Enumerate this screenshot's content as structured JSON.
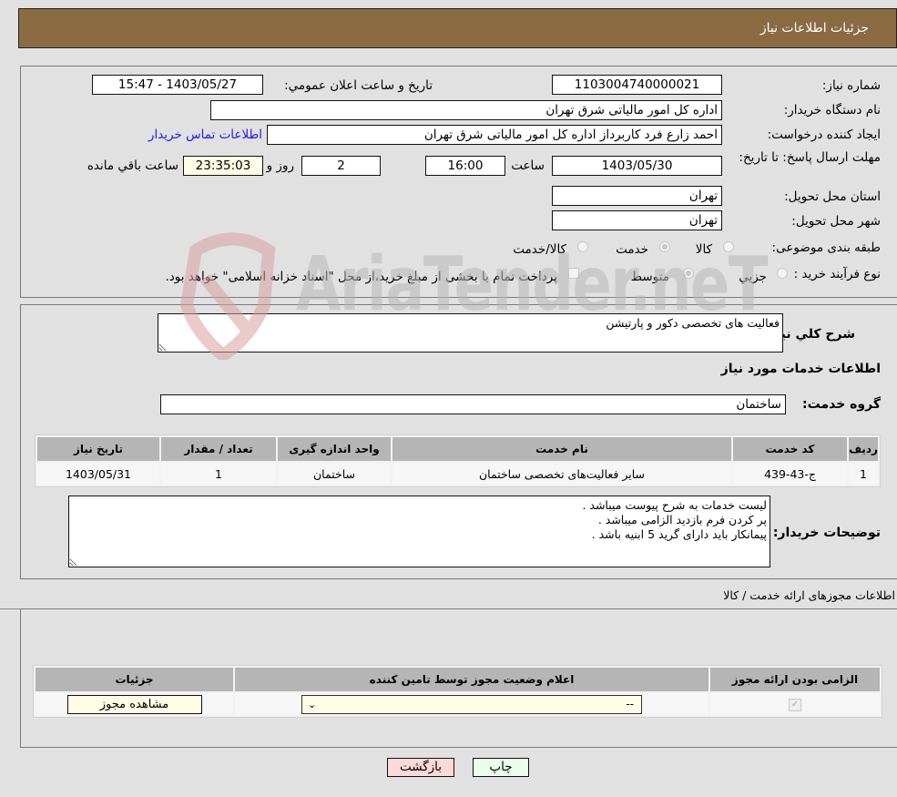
{
  "header": {
    "title": "جزئیات اطلاعات نیاز"
  },
  "info": {
    "need_number_label": "شماره نیاز:",
    "need_number": "1103004740000021",
    "announce_label": "تاریخ و ساعت اعلان عمومي:",
    "announce_value": "1403/05/27 - 15:47",
    "buyer_org_label": "نام دستگاه خریدار:",
    "buyer_org": "اداره کل امور مالیاتی شرق تهران",
    "creator_label": "ایجاد کننده درخواست:",
    "creator": "احمد  زارع فرد کاربرداز اداره کل امور مالیاتی شرق تهران",
    "buyer_contact_link": "اطلاعات تماس خریدار",
    "deadline_label": "مهلت ارسال پاسخ: تا تاریخ:",
    "deadline_date": "1403/05/30",
    "time_label": "ساعت",
    "deadline_time": "16:00",
    "days_value": "2",
    "days_label": "روز و",
    "remaining_time": "23:35:03",
    "remaining_label": "ساعت باقي مانده",
    "province_label": "استان محل تحویل:",
    "province": "تهران",
    "city_label": "شهر محل تحویل:",
    "city": "تهران",
    "category_label": "طبقه بندی موضوعی:",
    "category_options": [
      {
        "label": "کالا",
        "checked": false
      },
      {
        "label": "خدمت",
        "checked": true
      },
      {
        "label": "کالا/خدمت",
        "checked": false
      }
    ],
    "purchase_type_label": "نوع فرآیند خرید :",
    "purchase_type_options": [
      {
        "label": "جزیي",
        "checked": false
      },
      {
        "label": "متوسط",
        "checked": true
      }
    ],
    "treasury_checkbox_label": "پرداخت تمام یا بخشی از مبلغ خرید،از محل \"اسناد خزانه اسلامی\" خواهد بود.",
    "treasury_checked": false
  },
  "details": {
    "general_desc_label": "شرح کلي نیاز:",
    "general_desc": "فعالیت های تخصصی دکور و پارتیشن",
    "services_heading": "اطلاعات خدمات مورد نیاز",
    "service_group_label": "گروه خدمت:",
    "service_group": "ساختمان",
    "table": {
      "headers": [
        "ردیف",
        "کد خدمت",
        "نام خدمت",
        "واحد اندازه گیری",
        "تعداد / مقدار",
        "تاریخ نیاز"
      ],
      "rows": [
        [
          "1",
          "ج-43-439",
          "سایر فعالیت‌های تخصصی ساختمان",
          "ساختمان",
          "1",
          "1403/05/31"
        ]
      ]
    },
    "buyer_notes_label": "توضیحات خریدار:",
    "buyer_notes": "لیست خدمات به شرح پیوست میباشد .\nپر کردن فرم بازدید الزامی میباشد .\nپیمانکار باید دارای گرید 5 ابنیه باشد ."
  },
  "permits": {
    "heading": "اطلاعات مجوزهای ارائه خدمت / کالا",
    "headers": [
      "الزامی بودن ارائه مجوز",
      "اعلام وضعیت مجوز توسط تامین کننده",
      "جزئیات"
    ],
    "row": {
      "required_checked": true,
      "status_value": "--",
      "view_button": "مشاهده مجوز"
    }
  },
  "footer": {
    "print_label": "چاپ",
    "back_label": "بازگشت"
  },
  "colors": {
    "header_bg": "#8b6b42",
    "back_button_bg": "#ffd9d9",
    "print_button_bg": "#eaffea",
    "link": "#1a1aff"
  },
  "watermark": {
    "text": "AriaTender.neT"
  }
}
